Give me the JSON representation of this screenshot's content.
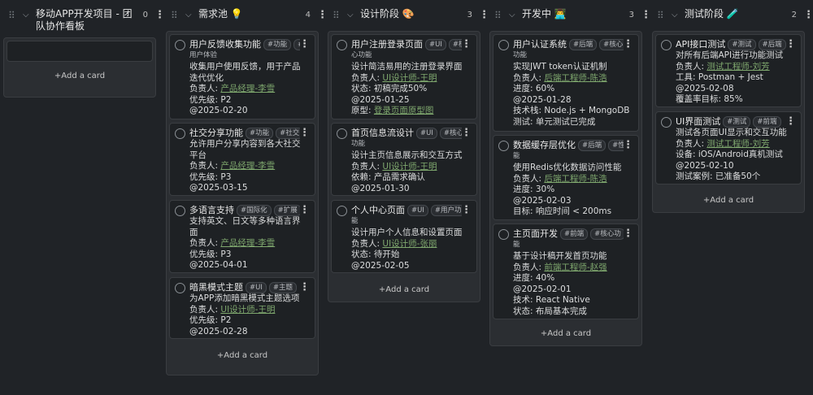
{
  "columns": [
    {
      "title_line1": "移动APP开发项目 - 团",
      "title_line2": "队协作看板",
      "count": "0",
      "add_card": "+Add a card",
      "cards": []
    },
    {
      "title": "需求池 💡",
      "count": "4",
      "add_card": "+Add a card",
      "cards": [
        {
          "title": "用户反馈收集功能",
          "tags": [
            "#功能",
            "#"
          ],
          "tag_overflow": "用户体验",
          "lines": [
            "收集用户使用反馈，用于产品",
            "迭代优化"
          ],
          "owner_label": "负责人: ",
          "owner": "产品经理-李雪",
          "extra": [
            "优先级: P2",
            "@2025-02-20"
          ]
        },
        {
          "title": "社交分享功能",
          "tags": [
            "#功能",
            "#社交"
          ],
          "lines": [
            "允许用户分享内容到各大社交",
            "平台"
          ],
          "owner_label": "负责人: ",
          "owner": "产品经理-李雪",
          "extra": [
            "优先级: P3",
            "@2025-03-15"
          ]
        },
        {
          "title": "多语言支持",
          "tags": [
            "#国际化",
            "#扩展"
          ],
          "lines": [
            "支持英文、日文等多种语言界",
            "面"
          ],
          "owner_label": "负责人: ",
          "owner": "产品经理-李雪",
          "extra": [
            "优先级: P3",
            "@2025-04-01"
          ]
        },
        {
          "title": "暗黑模式主题",
          "tags": [
            "#UI",
            "#主题"
          ],
          "lines": [
            "为APP添加暗黑模式主题选项"
          ],
          "owner_label": "负责人: ",
          "owner": "UI设计师-王明",
          "extra": [
            "优先级: P2",
            "@2025-02-28"
          ]
        }
      ]
    },
    {
      "title": "设计阶段 🎨",
      "count": "3",
      "add_card": "+Add a card",
      "cards": [
        {
          "title": "用户注册登录页面",
          "tags": [
            "#UI",
            "#核"
          ],
          "tag_overflow": "心功能",
          "lines": [
            "设计简洁易用的注册登录界面"
          ],
          "owner_label": "负责人: ",
          "owner": "UI设计师-王明",
          "extra": [
            "状态: 初稿完成50%",
            "@2025-01-25"
          ],
          "proto_label": "原型: ",
          "proto": "登录页面原型图"
        },
        {
          "title": "首页信息流设计",
          "tags": [
            "#UI",
            "#核心"
          ],
          "tag_overflow": "功能",
          "lines": [
            "设计主页信息展示和交互方式"
          ],
          "owner_label": "负责人: ",
          "owner": "UI设计师-王明",
          "extra": [
            "依赖: 产品需求确认",
            "@2025-01-30"
          ]
        },
        {
          "title": "个人中心页面",
          "tags": [
            "#UI",
            "#用户功"
          ],
          "tag_overflow": "能",
          "lines": [
            "设计用户个人信息和设置页面"
          ],
          "owner_label": "负责人: ",
          "owner": "UI设计师-张丽",
          "extra": [
            "状态: 待开始",
            "@2025-02-05"
          ]
        }
      ]
    },
    {
      "title": "开发中 👨‍💻",
      "count": "3",
      "add_card": "+Add a card",
      "cards": [
        {
          "title": "用户认证系统",
          "tags": [
            "#后端",
            "#核心"
          ],
          "tag_overflow": "功能",
          "lines": [
            "实现JWT token认证机制"
          ],
          "owner_label": "负责人: ",
          "owner": "后端工程师-陈浩",
          "extra": [
            "进度: 60%",
            "@2025-01-28",
            "技术栈: Node.js + MongoDB",
            "测试: 单元测试已完成"
          ]
        },
        {
          "title": "数据缓存层优化",
          "tags": [
            "#后端",
            "#性"
          ],
          "tag_overflow": "能",
          "lines": [
            "使用Redis优化数据访问性能"
          ],
          "owner_label": "负责人: ",
          "owner": "后端工程师-陈浩",
          "extra": [
            "进度: 30%",
            "@2025-02-03",
            "目标: 响应时间 < 200ms"
          ]
        },
        {
          "title": "主页面开发",
          "tags": [
            "#前端",
            "#核心功"
          ],
          "tag_overflow": "能",
          "lines": [
            "基于设计稿开发首页功能"
          ],
          "owner_label": "负责人: ",
          "owner": "前端工程师-赵强",
          "extra": [
            "进度: 40%",
            "@2025-02-01",
            "技术: React Native",
            "状态: 布局基本完成"
          ]
        }
      ]
    },
    {
      "title": "测试阶段 🧪",
      "count": "2",
      "add_card": "+Add a card",
      "cards": [
        {
          "title": "API接口测试",
          "tags": [
            "#测试",
            "#后端"
          ],
          "lines": [
            "对所有后端API进行功能测试"
          ],
          "owner_label": "负责人: ",
          "owner": "测试工程师-刘芳",
          "extra": [
            "工具: Postman + Jest",
            "@2025-02-08",
            "覆盖率目标: 85%"
          ]
        },
        {
          "title": "UI界面测试",
          "tags": [
            "#测试",
            "#前端"
          ],
          "lines": [
            "测试各页面UI显示和交互功能"
          ],
          "owner_label": "负责人: ",
          "owner": "测试工程师-刘芳",
          "extra": [
            "设备: iOS/Android真机测试",
            "@2025-02-10",
            "测试案例: 已准备50个"
          ]
        }
      ]
    }
  ]
}
